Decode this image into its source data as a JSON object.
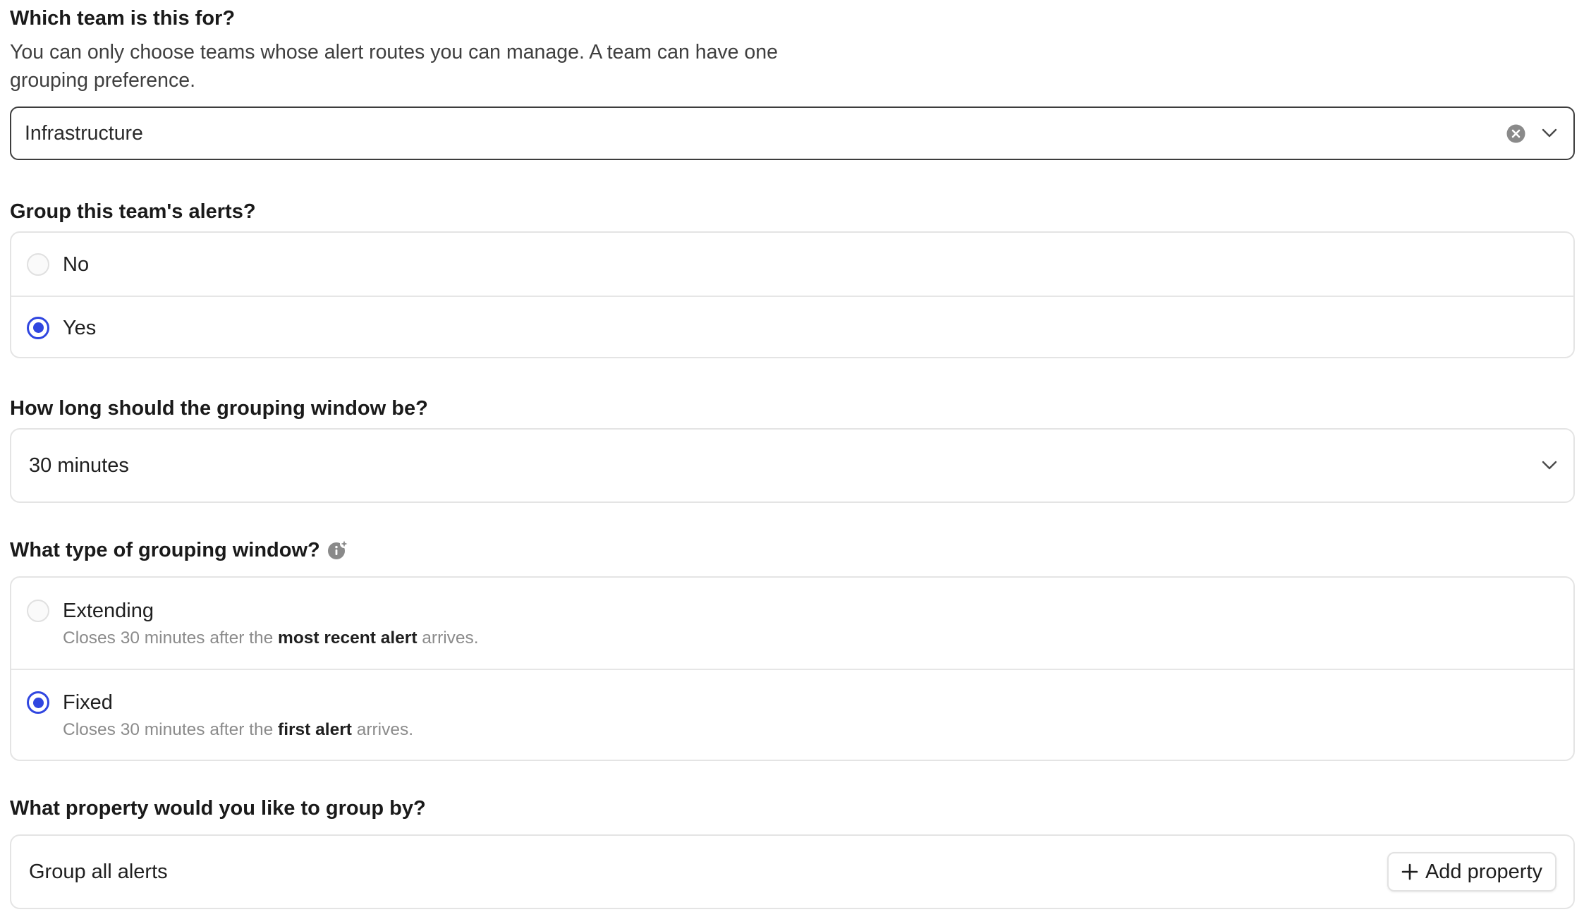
{
  "team": {
    "label": "Which team is this for?",
    "help": "You can only choose teams whose alert routes you can manage. A team can have one grouping preference.",
    "value": "Infrastructure",
    "clear_icon": "clear-circle-icon",
    "dropdown_icon": "chevron-down-icon"
  },
  "group_alerts": {
    "label": "Group this team's alerts?",
    "options": [
      {
        "label": "No",
        "checked": false
      },
      {
        "label": "Yes",
        "checked": true
      }
    ]
  },
  "window_length": {
    "label": "How long should the grouping window be?",
    "value": "30 minutes",
    "dropdown_icon": "chevron-down-icon"
  },
  "window_type": {
    "label": "What type of grouping window?",
    "info_icon": "info-sparkle-icon",
    "options": [
      {
        "label": "Extending",
        "checked": false,
        "desc_pre": "Closes 30 minutes after the ",
        "desc_bold": "most recent alert",
        "desc_post": " arrives."
      },
      {
        "label": "Fixed",
        "checked": true,
        "desc_pre": "Closes 30 minutes after the ",
        "desc_bold": "first alert",
        "desc_post": " arrives."
      }
    ]
  },
  "group_by": {
    "label": "What property would you like to group by?",
    "value": "Group all alerts",
    "add_button": "Add property",
    "add_icon": "plus-icon"
  },
  "colors": {
    "accent": "#3046e0",
    "border": "#e4e4e4",
    "text": "#1f1f1f",
    "muted": "#8b8b8b"
  }
}
